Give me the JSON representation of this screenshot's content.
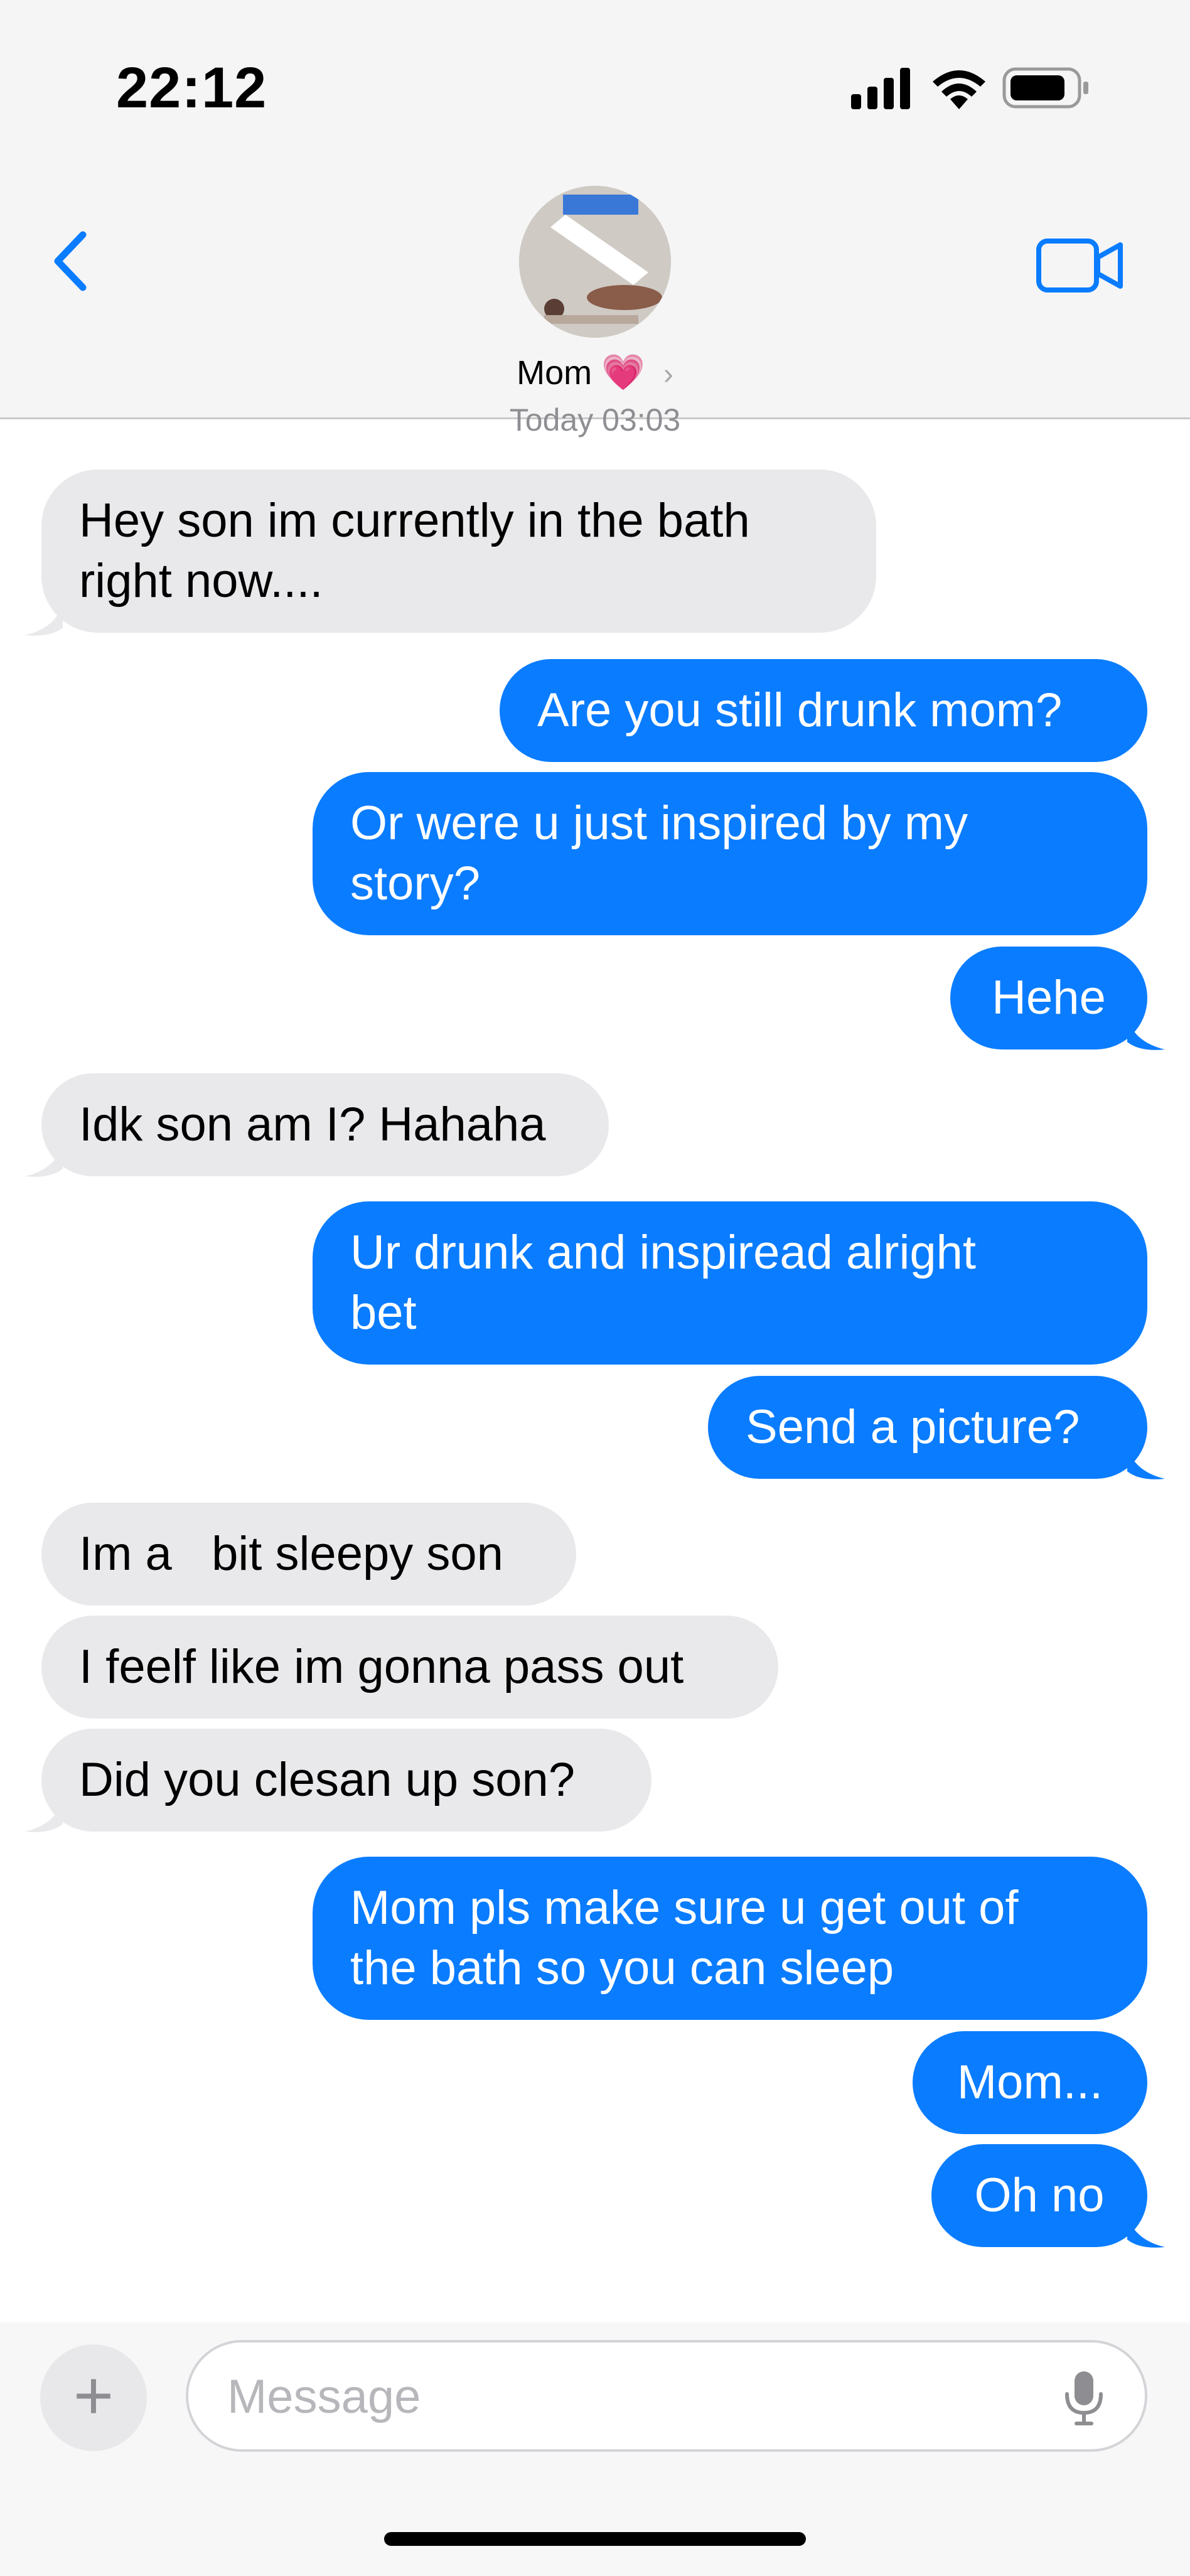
{
  "status": {
    "time": "22:12"
  },
  "header": {
    "contact_name": "Mom",
    "heart": "💗",
    "chevron": "›",
    "day_stamp": "Today 03:03"
  },
  "messages": [
    {
      "dir": "in",
      "text": "Hey son im currently in the bath\nright now...."
    },
    {
      "dir": "out",
      "text": "Are you still drunk mom?"
    },
    {
      "dir": "out",
      "text": "Or were u just inspired by my\nstory?"
    },
    {
      "dir": "out",
      "text": "Hehe"
    },
    {
      "dir": "in",
      "text": "Idk son am I? Hahaha"
    },
    {
      "dir": "out",
      "text": "Ur drunk and inspiread alright\nbet"
    },
    {
      "dir": "out",
      "text": "Send a picture?"
    },
    {
      "dir": "in",
      "text": "Im a   bit sleepy son"
    },
    {
      "dir": "in",
      "text": "I feelf like im gonna pass out"
    },
    {
      "dir": "in",
      "text": "Did you clesan up son?"
    },
    {
      "dir": "out",
      "text": "Mom pls make sure u get out of\nthe bath so you can sleep"
    },
    {
      "dir": "out",
      "text": "Mom..."
    },
    {
      "dir": "out",
      "text": "Oh no"
    }
  ],
  "composer": {
    "plus": "+",
    "placeholder": "Message"
  },
  "colors": {
    "accent": "#0a7cff",
    "incoming": "#e9e9eb",
    "heart": "#f24fa8"
  }
}
